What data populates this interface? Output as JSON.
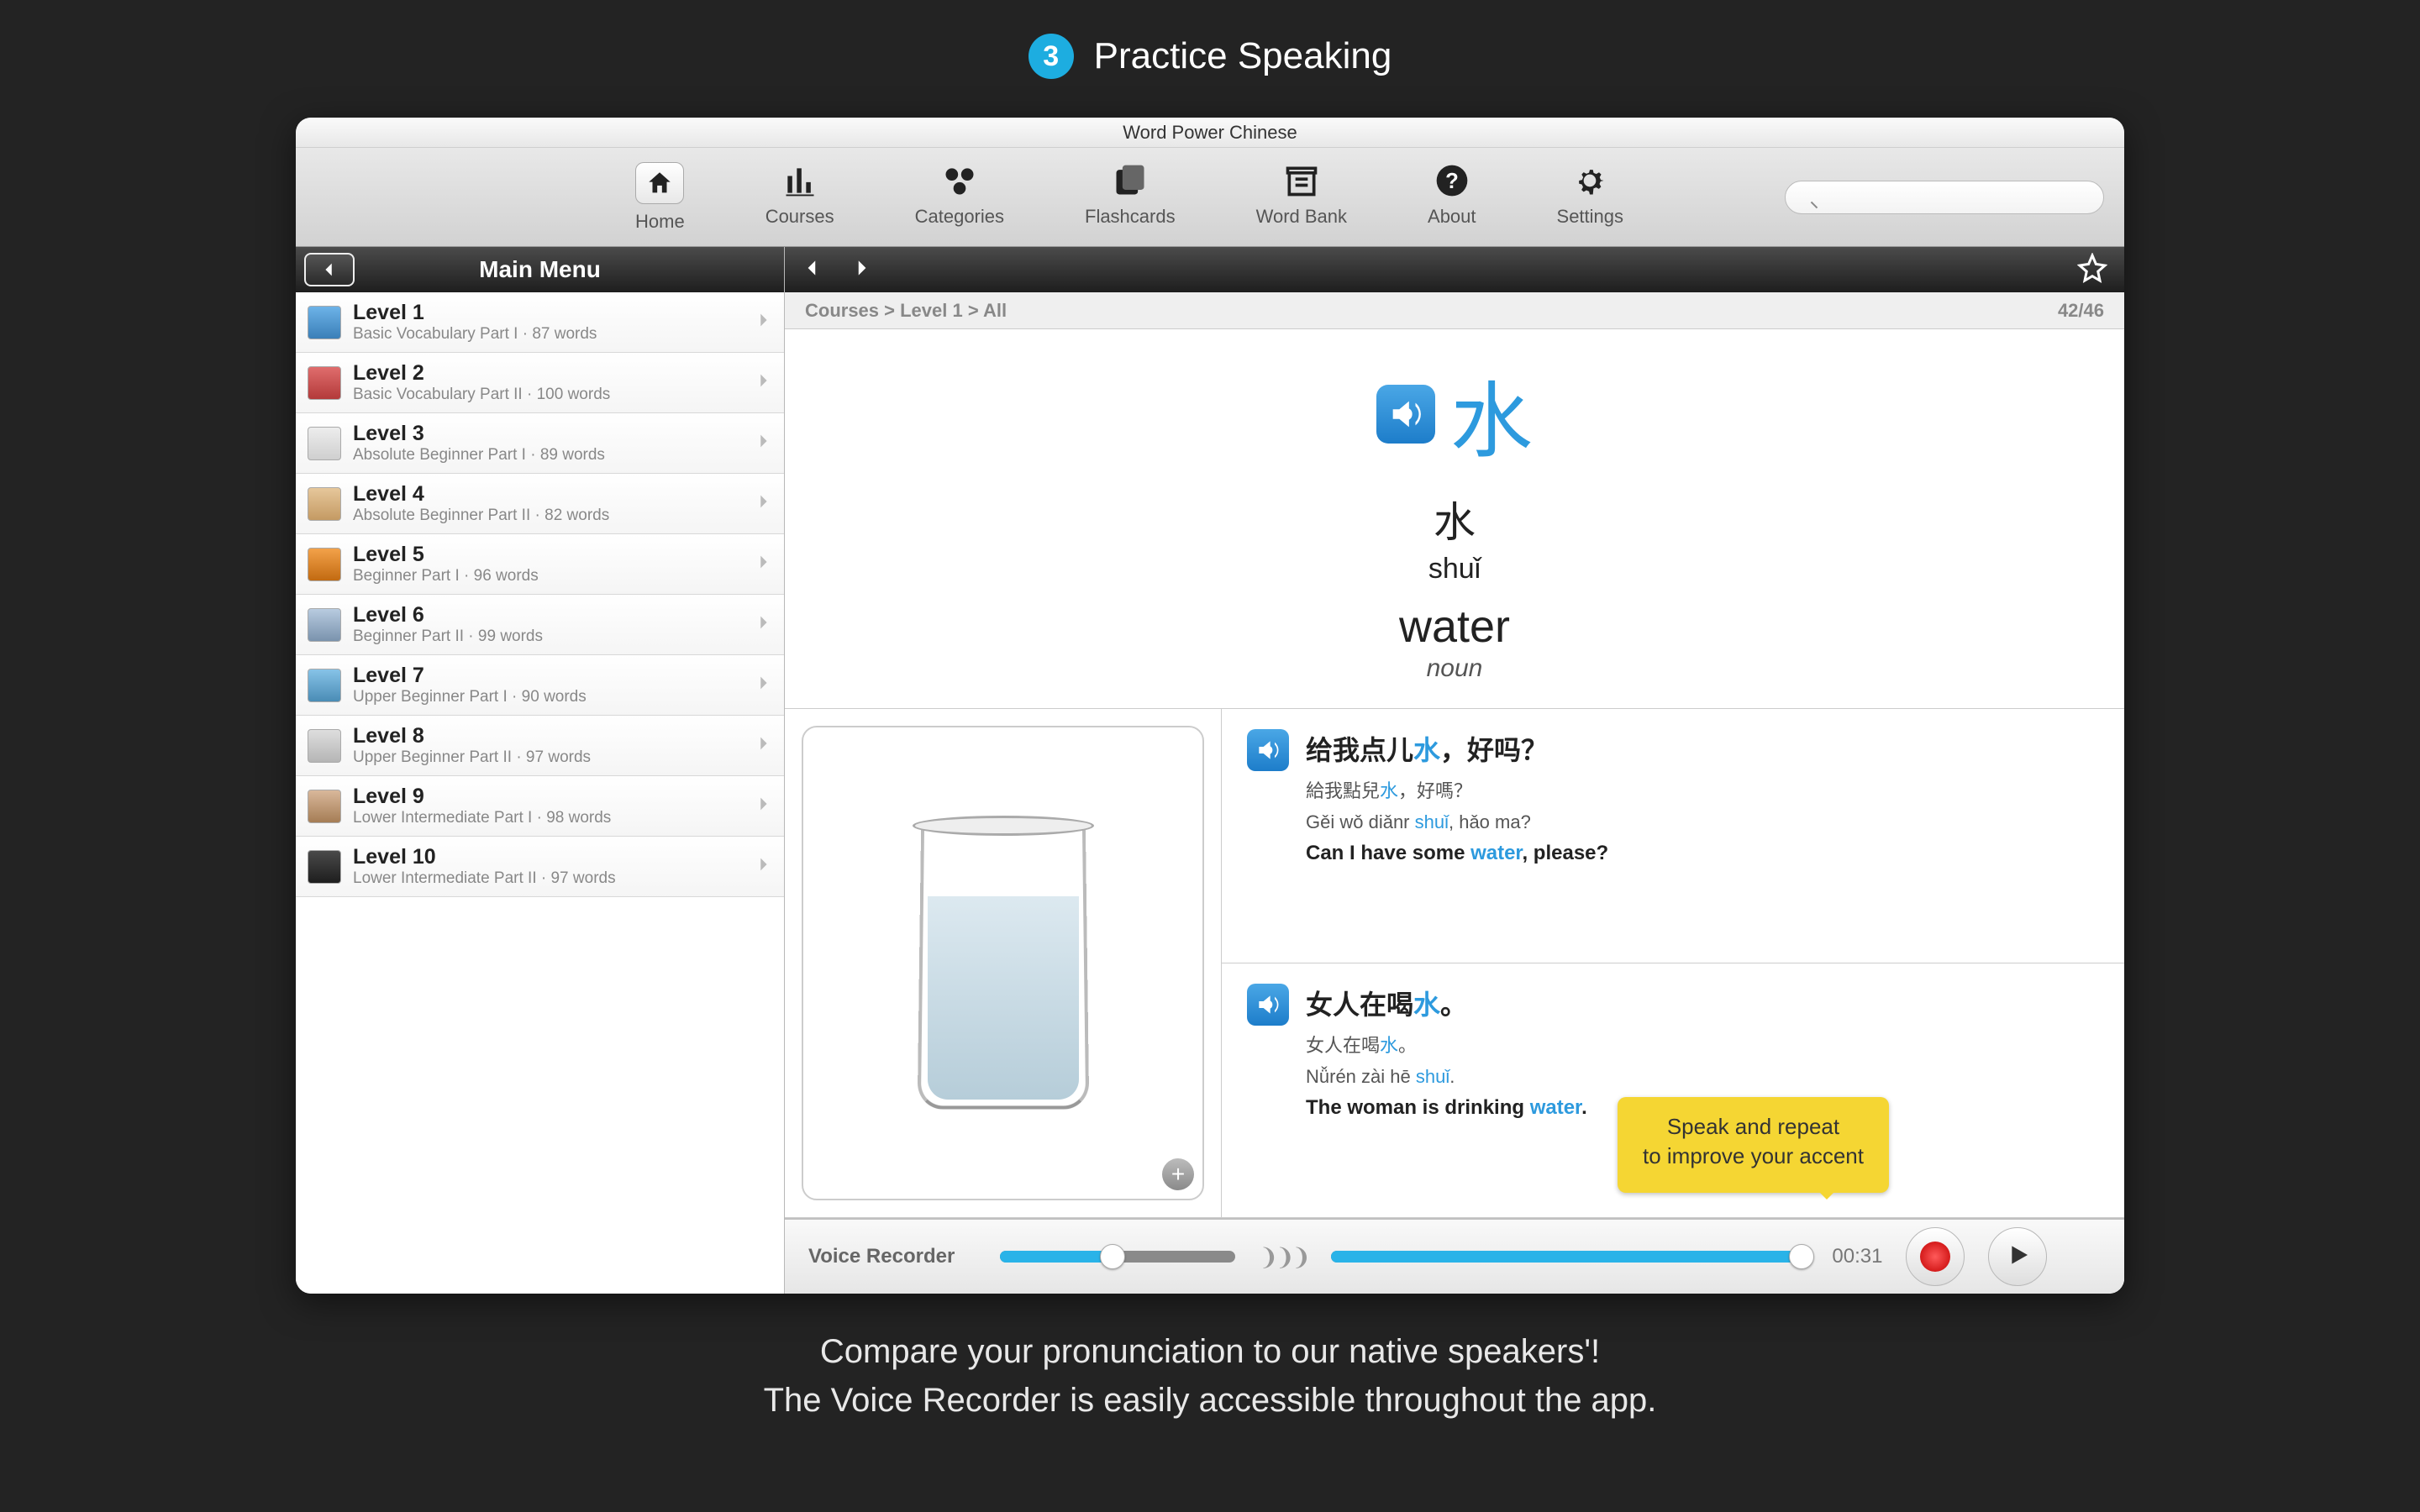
{
  "banner": {
    "step_number": "3",
    "title": "Practice Speaking"
  },
  "window": {
    "title": "Word Power Chinese"
  },
  "toolbar": {
    "home": "Home",
    "courses": "Courses",
    "categories": "Categories",
    "flashcards": "Flashcards",
    "wordbank": "Word Bank",
    "about": "About",
    "settings": "Settings",
    "search_placeholder": ""
  },
  "sidebar": {
    "title": "Main Menu",
    "levels": [
      {
        "name": "Level 1",
        "sub": "Basic Vocabulary Part I · 87 words"
      },
      {
        "name": "Level 2",
        "sub": "Basic Vocabulary Part II · 100 words"
      },
      {
        "name": "Level 3",
        "sub": "Absolute Beginner Part I · 89 words"
      },
      {
        "name": "Level 4",
        "sub": "Absolute Beginner Part II · 82 words"
      },
      {
        "name": "Level 5",
        "sub": "Beginner Part I · 96 words"
      },
      {
        "name": "Level 6",
        "sub": "Beginner Part II · 99 words"
      },
      {
        "name": "Level 7",
        "sub": "Upper Beginner Part I · 90 words"
      },
      {
        "name": "Level 8",
        "sub": "Upper Beginner Part II · 97 words"
      },
      {
        "name": "Level 9",
        "sub": "Lower Intermediate Part I · 98 words"
      },
      {
        "name": "Level 10",
        "sub": "Lower Intermediate Part II · 97 words"
      }
    ]
  },
  "breadcrumb": {
    "path": "Courses > Level 1 > All",
    "counter": "42/46"
  },
  "word": {
    "char": "水",
    "native": "水",
    "pinyin": "shuǐ",
    "english": "water",
    "pos": "noun"
  },
  "sentences": [
    {
      "simp_pre": "给我点儿",
      "simp_hl": "水",
      "simp_post": "，好吗？",
      "trad_pre": "給我點兒",
      "trad_hl": "水",
      "trad_post": "，好嗎？",
      "py_pre": "Gěi wǒ diǎnr ",
      "py_hl": "shuǐ",
      "py_post": ", hǎo ma?",
      "en_pre": "Can I have some ",
      "en_hl": "water",
      "en_post": ", please?"
    },
    {
      "simp_pre": "女人在喝",
      "simp_hl": "水",
      "simp_post": "。",
      "trad_pre": "女人在喝",
      "trad_hl": "水",
      "trad_post": "。",
      "py_pre": "Nǚrén zài hē ",
      "py_hl": "shuǐ",
      "py_post": ".",
      "en_pre": "The woman is drinking ",
      "en_hl": "water",
      "en_post": "."
    }
  ],
  "voice": {
    "label": "Voice Recorder",
    "time": "00:31",
    "track1_fill_pct": 48,
    "track2_fill_pct": 100
  },
  "callout": {
    "line1": "Speak and repeat",
    "line2": "to improve your accent"
  },
  "footer": {
    "line1": "Compare your pronunciation to our native speakers'!",
    "line2": "The Voice Recorder is easily accessible throughout the app."
  }
}
